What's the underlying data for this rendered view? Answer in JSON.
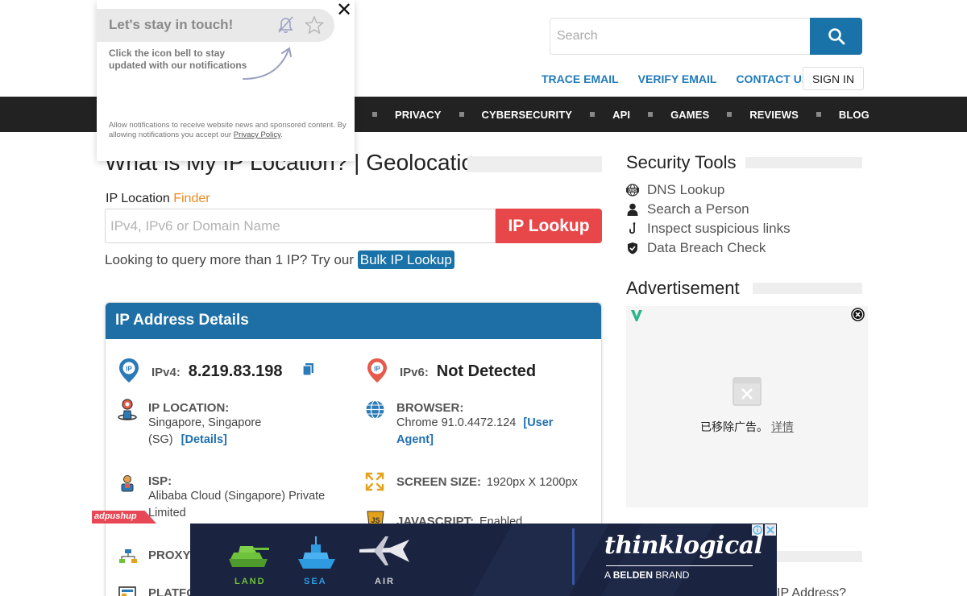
{
  "header": {
    "search_placeholder": "Search",
    "links": [
      "TRACE EMAIL",
      "VERIFY EMAIL",
      "CONTACT US"
    ],
    "signin_label": "SIGN IN"
  },
  "nav": {
    "items": [
      "PRIVACY",
      "CYBERSECURITY",
      "API",
      "GAMES",
      "REVIEWS",
      "BLOG"
    ]
  },
  "main": {
    "title": "What is My IP Location? | Geolocation",
    "iploc_label": "IP Location ",
    "iploc_accent": "Finder",
    "ip_input_placeholder": "IPv4, IPv6 or Domain Name",
    "ip_lookup_button": "IP Lookup",
    "bulk_text": "Looking to query more than 1 IP? Try our ",
    "bulk_link": "Bulk IP Lookup"
  },
  "card": {
    "heading": "IP Address Details",
    "ipv4_label": "IPv4:",
    "ipv4_value": "8.219.83.198",
    "ipv6_label": "IPv6:",
    "ipv6_value": "Not Detected",
    "ip_location_label": "IP LOCATION:",
    "ip_location_value": "Singapore, Singapore",
    "ip_location_value2": "(SG)",
    "details_link": "[Details]",
    "browser_label": "BROWSER:",
    "browser_value": "Chrome 91.0.4472.124",
    "user_agent_link1": "[User",
    "user_agent_link2": "Agent]",
    "isp_label": "ISP:",
    "isp_value1": "Alibaba Cloud (Singapore) Private",
    "isp_value2": "Limited",
    "screen_label": "SCREEN SIZE:",
    "screen_value": "1920px X 1200px",
    "proxy_label": "PROXY:",
    "javascript_label": "JAVASCRIPT:",
    "javascript_value": "Enabled",
    "platform_label": "PLATFO"
  },
  "sidebar": {
    "tools_title": "Security Tools",
    "tools": [
      "DNS Lookup",
      "Search a Person",
      "Inspect suspicious links",
      "Data Breach Check"
    ],
    "ad_title": "Advertisement",
    "ad_removed_text": "已移除广告。",
    "ad_details_link": "详情",
    "bottom_partial": "IP Address?"
  },
  "notification": {
    "title": "Let's stay in touch!",
    "text": "Click the icon bell to stay updated with our notifications",
    "small_text": "Allow notifications to receive website news and sponsored content. By allowing notifications you accept our ",
    "policy_link": "Privacy Policy",
    "policy_end": ".",
    "close": "✕"
  },
  "bottom_ad": {
    "badge": "adpushup",
    "land": "LAND",
    "sea": "SEA",
    "air": "AIR",
    "brand": "thinklogical",
    "brand_sub_prefix": "A ",
    "brand_sub_bold": "BELDEN",
    "brand_sub_suffix": " BRAND"
  },
  "colors": {
    "accent_blue": "#1e6fa5",
    "lookup_red": "#e8474a",
    "finder_orange": "#ea8a1f",
    "nav_bg": "#222222",
    "ad_bg": "#1a2340",
    "ad_green": "#6fc23b",
    "ad_blue": "#2e9be0"
  }
}
